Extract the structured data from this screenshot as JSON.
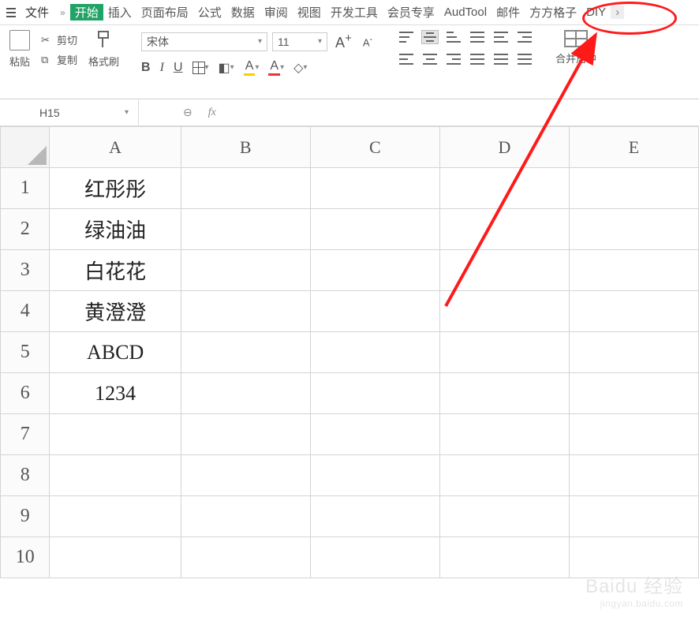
{
  "menu": {
    "file": "文件"
  },
  "tabs": {
    "items": [
      "开始",
      "插入",
      "页面布局",
      "公式",
      "数据",
      "审阅",
      "视图",
      "开发工具",
      "会员专享",
      "AudTool",
      "邮件",
      "方方格子",
      "DIY"
    ],
    "active_index": 0
  },
  "ribbon": {
    "clipboard": {
      "paste": "粘贴",
      "cut": "剪切",
      "copy": "复制",
      "format_painter": "格式刷"
    },
    "font": {
      "name": "宋体",
      "size": "11",
      "increase": "A+",
      "decrease": "A-",
      "bold": "B",
      "italic": "I",
      "underline": "U"
    },
    "merge": {
      "label": "合并居中"
    }
  },
  "namebox": {
    "ref": "H15"
  },
  "fx": {
    "label": "fx",
    "magnify": "�྾"
  },
  "columns": [
    "A",
    "B",
    "C",
    "D",
    "E"
  ],
  "rows": [
    "1",
    "2",
    "3",
    "4",
    "5",
    "6",
    "7",
    "8",
    "9",
    "10"
  ],
  "cells": {
    "A1": "红彤彤",
    "A2": "绿油油",
    "A3": "白花花",
    "A4": "黄澄澄",
    "A5": "ABCD",
    "A6": "1234"
  },
  "watermark": {
    "brand": "Baidu",
    "sub": "经验",
    "url": "jingyan.baidu.com"
  }
}
